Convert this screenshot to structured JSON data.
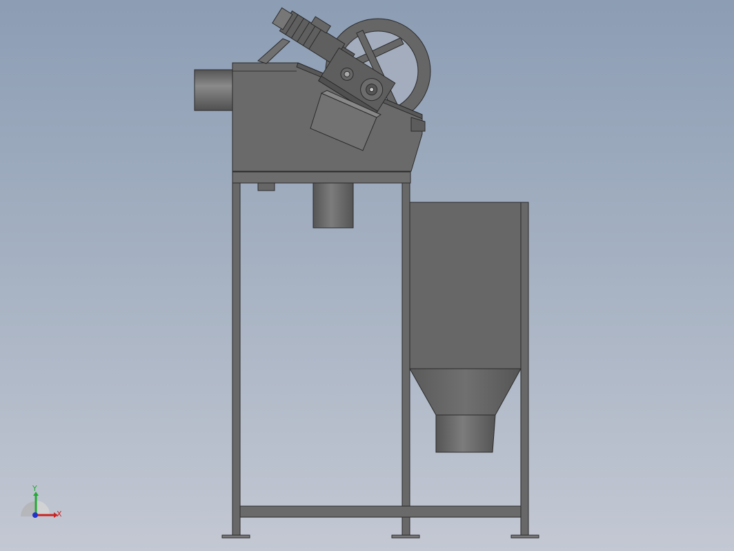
{
  "colors": {
    "background_top": "#8c9db4",
    "background_bottom": "#c3c8d3",
    "body_fill": "#6b6b6b",
    "edge": "#2a2a2a",
    "x_axis": "#cc2222",
    "y_axis": "#22aa33",
    "z_axis": "#2233cc"
  },
  "triad": {
    "x_label": "X",
    "y_label": "Y",
    "icon": "coordinate-triad-icon"
  }
}
